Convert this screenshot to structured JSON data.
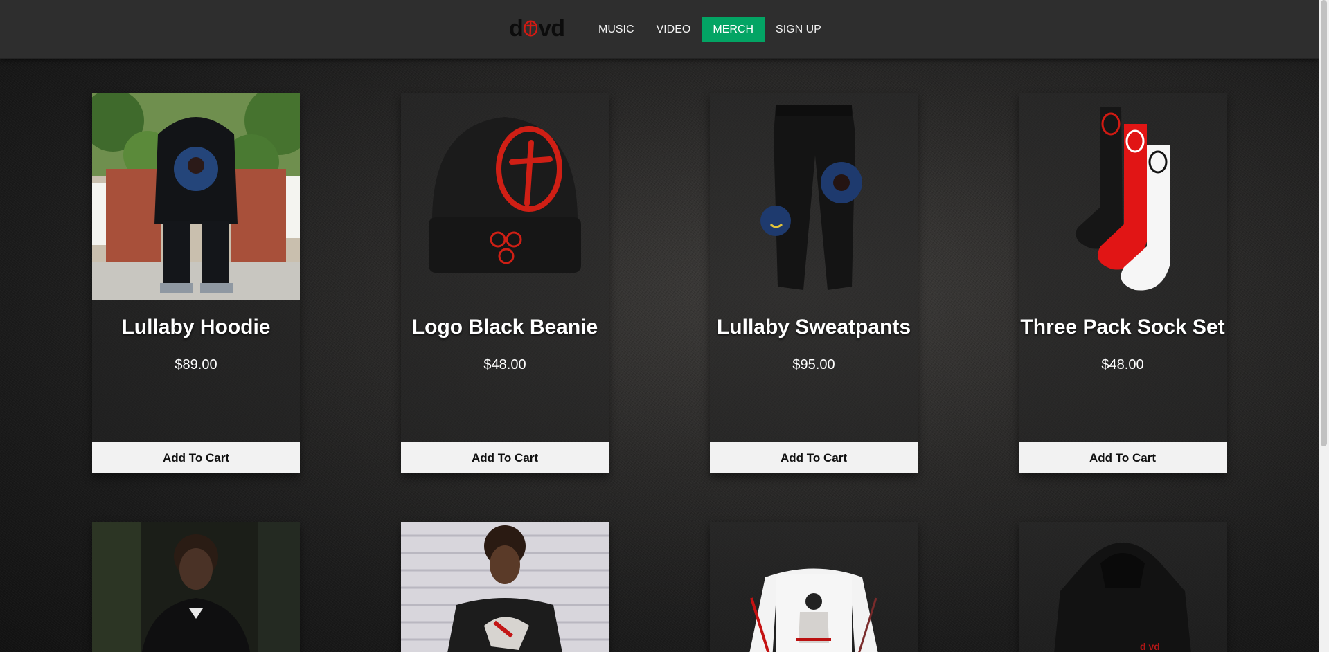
{
  "header": {
    "logo_text": "d vd",
    "nav": [
      {
        "label": "MUSIC",
        "active": false
      },
      {
        "label": "VIDEO",
        "active": false
      },
      {
        "label": "MERCH",
        "active": true
      },
      {
        "label": "SIGN UP",
        "active": false
      }
    ]
  },
  "colors": {
    "nav_active": "#03a464",
    "button_bg": "#f2f2f2",
    "logo_red": "#d41a12"
  },
  "products": [
    {
      "name": "Lullaby Hoodie",
      "price": "$89.00",
      "button": "Add To Cart",
      "image": "hoodie-back-photo"
    },
    {
      "name": "Logo Black Beanie",
      "price": "$48.00",
      "button": "Add To Cart",
      "image": "black-beanie-red-logo"
    },
    {
      "name": "Lullaby Sweatpants",
      "price": "$95.00",
      "button": "Add To Cart",
      "image": "black-sweatpants-patch"
    },
    {
      "name": "Three Pack Sock Set",
      "price": "$48.00",
      "button": "Add To Cart",
      "image": "black-red-white-socks"
    }
  ],
  "products_row2": [
    {
      "image": "person-black-hoodie-photo"
    },
    {
      "image": "person-black-tee-photo"
    },
    {
      "image": "white-longsleeve-print"
    },
    {
      "image": "black-hoodie-logo"
    }
  ]
}
